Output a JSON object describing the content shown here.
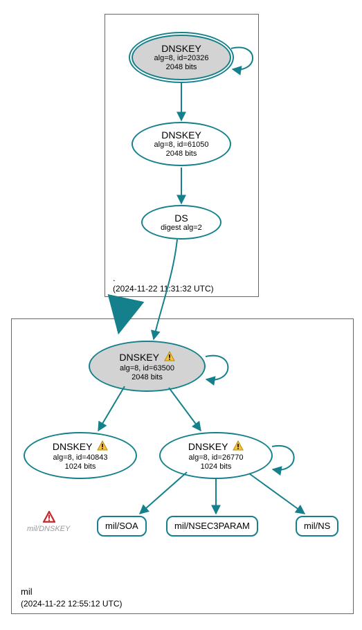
{
  "colors": {
    "stroke": "#14808c",
    "grey_fill": "#d3d3d3"
  },
  "zone_root": {
    "name": ".",
    "timestamp": "(2024-11-22 11:31:32 UTC)"
  },
  "zone_mil": {
    "name": "mil",
    "timestamp": "(2024-11-22 12:55:12 UTC)"
  },
  "root_ksk": {
    "title": "DNSKEY",
    "line2": "alg=8, id=20326",
    "line3": "2048 bits"
  },
  "root_zsk": {
    "title": "DNSKEY",
    "line2": "alg=8, id=61050",
    "line3": "2048 bits"
  },
  "root_ds": {
    "title": "DS",
    "line2": "digest alg=2"
  },
  "mil_ksk": {
    "title_prefix": "DNSKEY",
    "line2": "alg=8, id=63500",
    "line3": "2048 bits"
  },
  "mil_zsk1": {
    "title_prefix": "DNSKEY",
    "line2": "alg=8, id=40843",
    "line3": "1024 bits"
  },
  "mil_zsk2": {
    "title_prefix": "DNSKEY",
    "line2": "alg=8, id=26770",
    "line3": "1024 bits"
  },
  "rr1": {
    "label": "mil/SOA"
  },
  "rr2": {
    "label": "mil/NSEC3PARAM"
  },
  "rr3": {
    "label": "mil/NS"
  },
  "hidden_label": "mil/DNSKEY",
  "chart_data": {
    "type": "diagram",
    "nodes": [
      {
        "id": "root_ksk",
        "zone": ".",
        "type": "DNSKEY",
        "alg": 8,
        "key_id": 20326,
        "bits": 2048,
        "ksk": true,
        "status": "ok"
      },
      {
        "id": "root_zsk",
        "zone": ".",
        "type": "DNSKEY",
        "alg": 8,
        "key_id": 61050,
        "bits": 2048,
        "ksk": false,
        "status": "ok"
      },
      {
        "id": "root_ds",
        "zone": ".",
        "type": "DS",
        "digest_alg": 2
      },
      {
        "id": "mil_ksk",
        "zone": "mil",
        "type": "DNSKEY",
        "alg": 8,
        "key_id": 63500,
        "bits": 2048,
        "ksk": true,
        "status": "warning"
      },
      {
        "id": "mil_zsk1",
        "zone": "mil",
        "type": "DNSKEY",
        "alg": 8,
        "key_id": 40843,
        "bits": 1024,
        "ksk": false,
        "status": "warning"
      },
      {
        "id": "mil_zsk2",
        "zone": "mil",
        "type": "DNSKEY",
        "alg": 8,
        "key_id": 26770,
        "bits": 1024,
        "ksk": false,
        "status": "warning"
      },
      {
        "id": "mil_soa",
        "zone": "mil",
        "type": "RRset",
        "name": "mil/SOA"
      },
      {
        "id": "mil_nsec3",
        "zone": "mil",
        "type": "RRset",
        "name": "mil/NSEC3PARAM"
      },
      {
        "id": "mil_ns",
        "zone": "mil",
        "type": "RRset",
        "name": "mil/NS"
      },
      {
        "id": "mil_hidden",
        "zone": "mil",
        "type": "DNSKEY-set",
        "name": "mil/DNSKEY",
        "status": "error"
      }
    ],
    "edges": [
      {
        "from": "root_ksk",
        "to": "root_ksk",
        "kind": "self"
      },
      {
        "from": "root_ksk",
        "to": "root_zsk"
      },
      {
        "from": "root_zsk",
        "to": "root_ds"
      },
      {
        "from": "root_ds",
        "to": "mil_ksk"
      },
      {
        "from": "mil_ksk",
        "to": "mil_ksk",
        "kind": "self"
      },
      {
        "from": "mil_ksk",
        "to": "mil_zsk1"
      },
      {
        "from": "mil_ksk",
        "to": "mil_zsk2"
      },
      {
        "from": "mil_zsk2",
        "to": "mil_zsk2",
        "kind": "self"
      },
      {
        "from": "mil_zsk2",
        "to": "mil_soa"
      },
      {
        "from": "mil_zsk2",
        "to": "mil_nsec3"
      },
      {
        "from": "mil_zsk2",
        "to": "mil_ns"
      }
    ],
    "zones": [
      {
        "name": ".",
        "timestamp_utc": "2024-11-22 11:31:32"
      },
      {
        "name": "mil",
        "timestamp_utc": "2024-11-22 12:55:12"
      }
    ]
  }
}
